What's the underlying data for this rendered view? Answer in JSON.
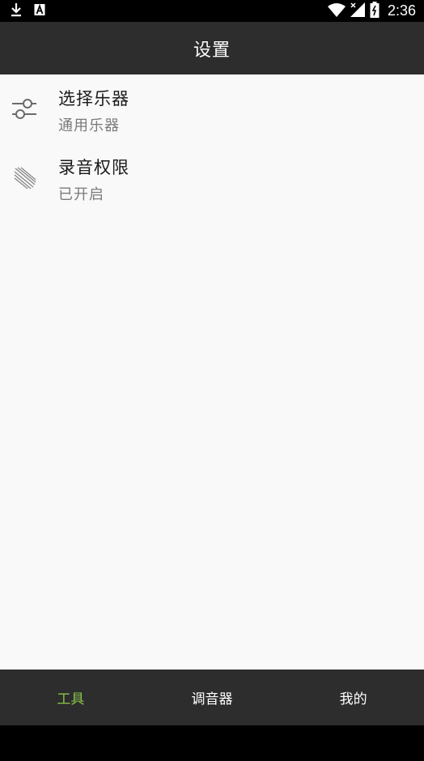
{
  "status_bar": {
    "time": "2:36",
    "left_icons": [
      "download-icon",
      "a-badge-icon"
    ],
    "right_icons": [
      "wifi-icon",
      "signal-icon",
      "battery-icon"
    ]
  },
  "header": {
    "title": "设置"
  },
  "settings": [
    {
      "title": "选择乐器",
      "subtitle": "通用乐器",
      "icon": "sliders-icon"
    },
    {
      "title": "录音权限",
      "subtitle": "已开启",
      "icon": "microphone-icon"
    }
  ],
  "bottom_nav": {
    "tabs": [
      {
        "label": "工具",
        "active": true
      },
      {
        "label": "调音器",
        "active": false
      },
      {
        "label": "我的",
        "active": false
      }
    ]
  },
  "colors": {
    "accent": "#8bc34a",
    "bar_background": "#2d2d2d",
    "content_background": "#f9f9f9"
  }
}
